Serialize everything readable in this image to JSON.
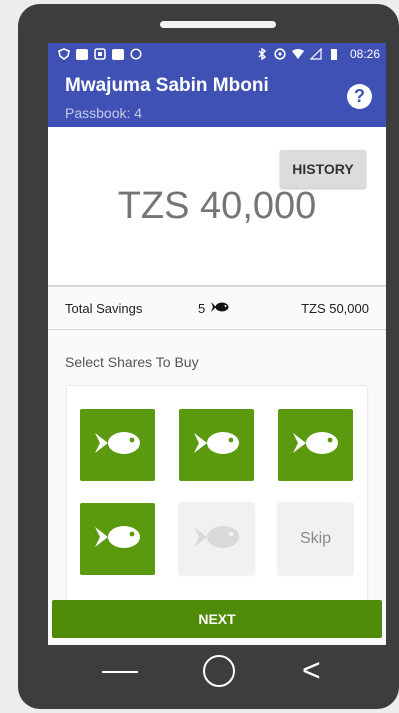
{
  "status_bar": {
    "time": "08:26",
    "left_icons": [
      "shield-icon",
      "image-icon",
      "message-icon",
      "photo-icon",
      "whatsapp-icon"
    ],
    "right_icons": [
      "bluetooth-icon",
      "alarm-icon",
      "wifi-icon",
      "signal-icon",
      "battery-icon"
    ]
  },
  "header": {
    "name": "Mwajuma Sabin Mboni",
    "passbook": "Passbook: 4",
    "help_label": "?"
  },
  "balance": {
    "history_label": "HISTORY",
    "amount": "TZS 40,000"
  },
  "totals": {
    "label": "Total Savings",
    "count": "5",
    "value": "TZS 50,000"
  },
  "shares": {
    "title": "Select Shares To Buy",
    "tiles": [
      {
        "state": "on",
        "icon": "fish-icon"
      },
      {
        "state": "on",
        "icon": "fish-icon"
      },
      {
        "state": "on",
        "icon": "fish-icon"
      },
      {
        "state": "on",
        "icon": "fish-icon"
      },
      {
        "state": "off",
        "icon": "fish-icon"
      },
      {
        "state": "skip",
        "label": "Skip"
      }
    ]
  },
  "footer": {
    "next_label": "NEXT"
  },
  "colors": {
    "primary": "#3f51b5",
    "accent_green": "#5b9a0f",
    "next_green": "#4f8a08"
  }
}
